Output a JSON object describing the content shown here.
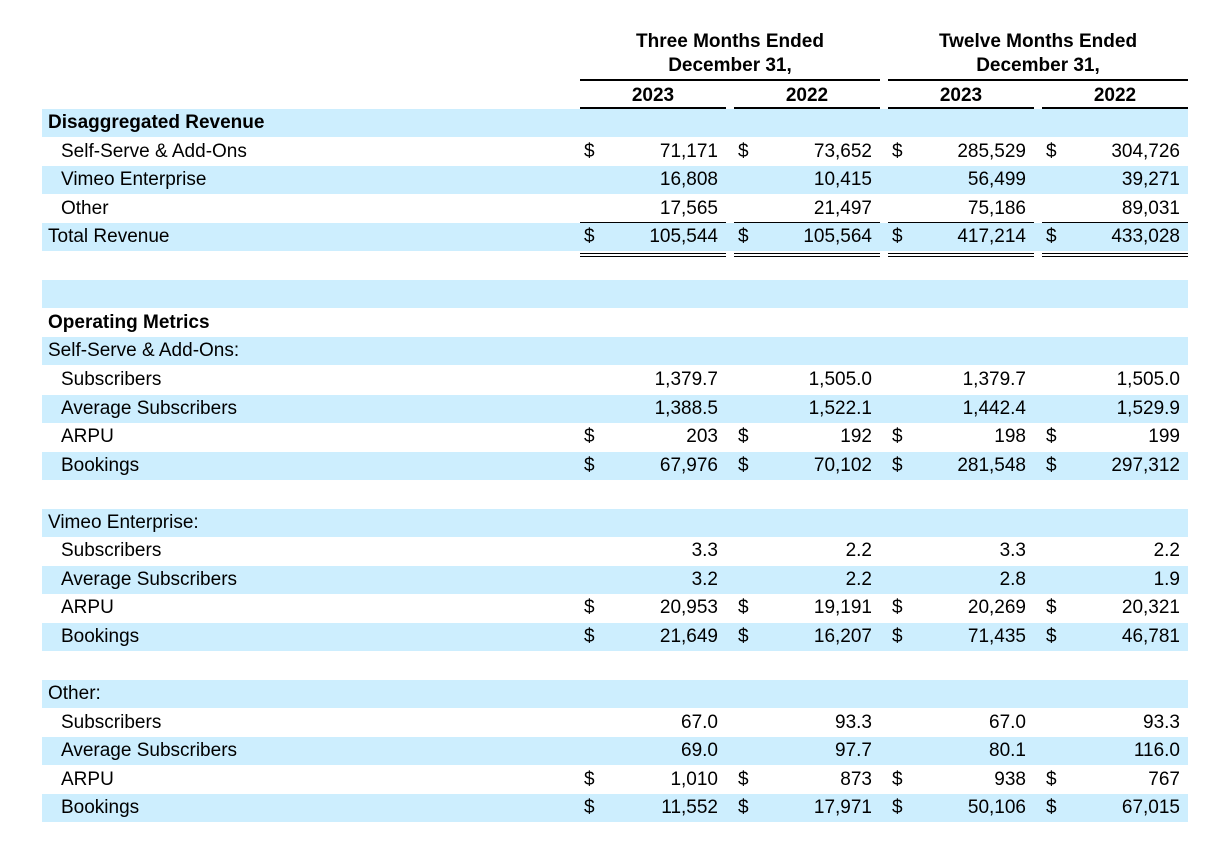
{
  "header": {
    "three_months": "Three Months Ended\nDecember 31,",
    "three_months_line1": "Three Months Ended",
    "three_months_line2": "December 31,",
    "twelve_months_line1": "Twelve Months Ended",
    "twelve_months_line2": "December 31,",
    "years": [
      "2023",
      "2022",
      "2023",
      "2022"
    ]
  },
  "rows": [
    {
      "label": "Disaggregated Revenue",
      "style": "section",
      "shade": true,
      "values": []
    },
    {
      "label": "Self-Serve & Add-Ons",
      "style": "indent",
      "shade": false,
      "dollar": true,
      "values": [
        "71,171",
        "73,652",
        "285,529",
        "304,726"
      ]
    },
    {
      "label": "Vimeo Enterprise",
      "style": "indent",
      "shade": true,
      "dollar": false,
      "values": [
        "16,808",
        "10,415",
        "56,499",
        "39,271"
      ]
    },
    {
      "label": "Other",
      "style": "indent",
      "shade": false,
      "dollar": false,
      "values": [
        "17,565",
        "21,497",
        "75,186",
        "89,031"
      ]
    },
    {
      "label": "Total Revenue",
      "style": "plain",
      "shade": true,
      "dollar": true,
      "total": true,
      "values": [
        "105,544",
        "105,564",
        "417,214",
        "433,028"
      ]
    },
    {
      "label": "",
      "style": "blank",
      "shade": false,
      "values": []
    },
    {
      "label": "",
      "style": "blank",
      "shade": true,
      "values": []
    },
    {
      "label": "Operating Metrics",
      "style": "section",
      "shade": false,
      "values": []
    },
    {
      "label": "Self-Serve & Add-Ons:",
      "style": "plain",
      "shade": true,
      "values": []
    },
    {
      "label": "Subscribers",
      "style": "indent",
      "shade": false,
      "dollar": false,
      "values": [
        "1,379.7",
        "1,505.0",
        "1,379.7",
        "1,505.0"
      ]
    },
    {
      "label": "Average Subscribers",
      "style": "indent",
      "shade": true,
      "dollar": false,
      "values": [
        "1,388.5",
        "1,522.1",
        "1,442.4",
        "1,529.9"
      ]
    },
    {
      "label": "ARPU",
      "style": "indent",
      "shade": false,
      "dollar": true,
      "values": [
        "203",
        "192",
        "198",
        "199"
      ]
    },
    {
      "label": "Bookings",
      "style": "indent",
      "shade": true,
      "dollar": true,
      "values": [
        "67,976",
        "70,102",
        "281,548",
        "297,312"
      ]
    },
    {
      "label": "",
      "style": "blank",
      "shade": false,
      "values": []
    },
    {
      "label": "Vimeo Enterprise:",
      "style": "plain",
      "shade": true,
      "values": []
    },
    {
      "label": "Subscribers",
      "style": "indent",
      "shade": false,
      "dollar": false,
      "values": [
        "3.3",
        "2.2",
        "3.3",
        "2.2"
      ]
    },
    {
      "label": "Average Subscribers",
      "style": "indent",
      "shade": true,
      "dollar": false,
      "values": [
        "3.2",
        "2.2",
        "2.8",
        "1.9"
      ]
    },
    {
      "label": "ARPU",
      "style": "indent",
      "shade": false,
      "dollar": true,
      "values": [
        "20,953",
        "19,191",
        "20,269",
        "20,321"
      ]
    },
    {
      "label": "Bookings",
      "style": "indent",
      "shade": true,
      "dollar": true,
      "values": [
        "21,649",
        "16,207",
        "71,435",
        "46,781"
      ]
    },
    {
      "label": "",
      "style": "blank",
      "shade": false,
      "values": []
    },
    {
      "label": "Other:",
      "style": "plain",
      "shade": true,
      "values": []
    },
    {
      "label": "Subscribers",
      "style": "indent",
      "shade": false,
      "dollar": false,
      "values": [
        "67.0",
        "93.3",
        "67.0",
        "93.3"
      ]
    },
    {
      "label": "Average Subscribers",
      "style": "indent",
      "shade": true,
      "dollar": false,
      "values": [
        "69.0",
        "97.7",
        "80.1",
        "116.0"
      ]
    },
    {
      "label": "ARPU",
      "style": "indent",
      "shade": false,
      "dollar": true,
      "values": [
        "1,010",
        "873",
        "938",
        "767"
      ]
    },
    {
      "label": "Bookings",
      "style": "indent",
      "shade": true,
      "dollar": true,
      "values": [
        "11,552",
        "17,971",
        "50,106",
        "67,015"
      ]
    }
  ],
  "currency_symbol": "$"
}
